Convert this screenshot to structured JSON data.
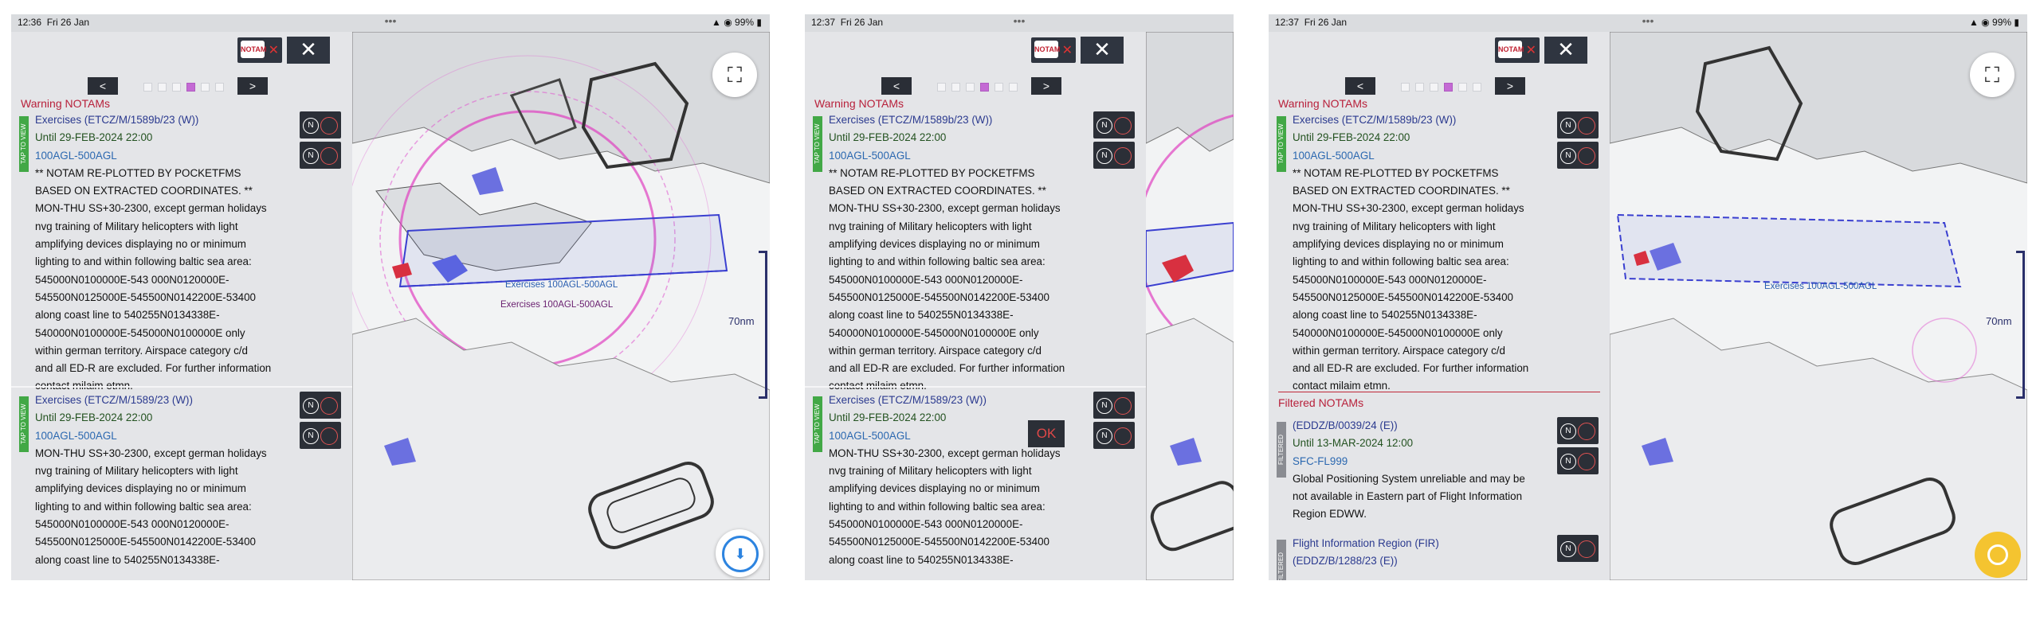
{
  "screens": [
    {
      "status": {
        "time": "12:36",
        "date": "Fri 26 Jan",
        "battery": "99%"
      },
      "section": "Warning NOTAMs",
      "map_labels": [
        "Exercises 100AGL-500AGL",
        "Exercises 100AGL-500AGL"
      ],
      "scale": "70nm",
      "entries": [
        {
          "tab": "TAP TO VIEW",
          "head": "Exercises  (ETCZ/M/1589b/23 (W))",
          "until": "Until 29-FEB-2024 22:00",
          "alt": "100AGL-500AGL",
          "lines": [
            "** NOTAM RE-PLOTTED BY POCKETFMS",
            "BASED ON EXTRACTED COORDINATES. **",
            "MON-THU SS+30-2300, except german holidays",
            "nvg training of Military helicopters with light",
            "amplifying devices displaying no or minimum",
            "lighting to and within following baltic sea area:",
            "545000N0100000E-543 000N0120000E-",
            "545500N0125000E-545500N0142200E-53400",
            "along coast line to 540255N0134338E-",
            "540000N0100000E-545000N0100000E only",
            "within german territory. Airspace category  c/d",
            "and all ED-R are excluded. For further information",
            "contact milaim etmn."
          ]
        },
        {
          "tab": "TAP TO VIEW",
          "head": "Exercises  (ETCZ/M/1589/23 (W))",
          "until": "Until 29-FEB-2024 22:00",
          "alt": "100AGL-500AGL",
          "lines": [
            "MON-THU SS+30-2300, except german holidays",
            "nvg training of Military helicopters with light",
            "amplifying devices displaying no or minimum",
            "lighting to and within following baltic sea area:",
            "545000N0100000E-543 000N0120000E-",
            "545500N0125000E-545500N0142200E-53400",
            "along coast line to 540255N0134338E-"
          ]
        }
      ]
    },
    {
      "status": {
        "time": "12:37",
        "date": "Fri 26 Jan"
      },
      "section": "Warning NOTAMs",
      "ok": "OK",
      "entries": [
        {
          "tab": "TAP TO VIEW",
          "head": "Exercises  (ETCZ/M/1589b/23 (W))",
          "until": "Until 29-FEB-2024 22:00",
          "alt": "100AGL-500AGL",
          "lines": [
            "** NOTAM RE-PLOTTED BY POCKETFMS",
            "BASED ON EXTRACTED COORDINATES. **",
            "MON-THU SS+30-2300, except german holidays",
            "nvg training of Military helicopters with light",
            "amplifying devices displaying no or minimum",
            "lighting to and within following baltic sea area:",
            "545000N0100000E-543 000N0120000E-",
            "545500N0125000E-545500N0142200E-53400",
            "along coast line to 540255N0134338E-",
            "540000N0100000E-545000N0100000E only",
            "within german territory. Airspace category  c/d",
            "and all ED-R are excluded. For further information",
            "contact milaim etmn."
          ]
        },
        {
          "tab": "TAP TO VIEW",
          "head": "Exercises  (ETCZ/M/1589/23 (W))",
          "until": "Until 29-FEB-2024 22:00",
          "alt": "100AGL-500AGL",
          "lines": [
            "MON-THU SS+30-2300, except german holidays",
            "nvg training of Military helicopters with light",
            "amplifying devices displaying no or minimum",
            "lighting to and within following baltic sea area:",
            "545000N0100000E-543 000N0120000E-",
            "545500N0125000E-545500N0142200E-53400",
            "along coast line to 540255N0134338E-"
          ]
        }
      ]
    },
    {
      "status": {
        "time": "12:37",
        "date": "Fri 26 Jan",
        "battery": "99%"
      },
      "section": "Warning NOTAMs",
      "section2": "Filtered NOTAMs",
      "map_labels": [
        "Exercises 100AGL-500AGL"
      ],
      "scale": "70nm",
      "entries": [
        {
          "tab": "TAP TO VIEW",
          "head": "Exercises  (ETCZ/M/1589b/23 (W))",
          "until": "Until 29-FEB-2024 22:00",
          "alt": "100AGL-500AGL",
          "lines": [
            "** NOTAM RE-PLOTTED BY POCKETFMS",
            "BASED ON EXTRACTED COORDINATES. **",
            "MON-THU SS+30-2300, except german holidays",
            "nvg training of Military helicopters with light",
            "amplifying devices displaying no or minimum",
            "lighting to and within following baltic sea area:",
            "545000N0100000E-543 000N0120000E-",
            "545500N0125000E-545500N0142200E-53400",
            "along coast line to 540255N0134338E-",
            "540000N0100000E-545000N0100000E only",
            "within german territory. Airspace category  c/d",
            "and all ED-R are excluded. For further information",
            "contact milaim etmn."
          ]
        }
      ],
      "filtered": [
        {
          "tab": "FILTERED",
          "head": "(EDDZ/B/0039/24 (E))",
          "until": "Until 13-MAR-2024 12:00",
          "alt": "SFC-FL999",
          "lines": [
            "Global Positioning System unreliable and may be",
            "not available in Eastern part of Flight Information",
            "Region EDWW."
          ]
        },
        {
          "tab": "FILTERED",
          "head": "Flight Information Region (FIR)",
          "until": "(EDDZ/B/1288/23 (E))",
          "alt": "",
          "lines": []
        }
      ]
    }
  ]
}
